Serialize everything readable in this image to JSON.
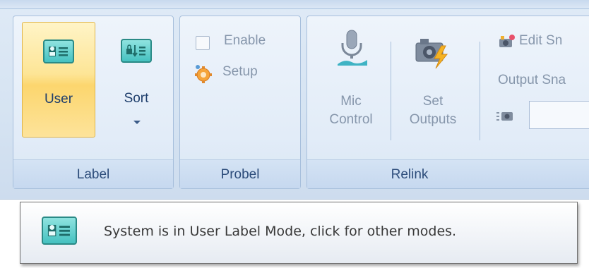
{
  "ribbon": {
    "label_group": {
      "title": "Label",
      "user_button": "User",
      "sort_button": "Sort"
    },
    "probel_group": {
      "title": "Probel",
      "enable_label": "Enable",
      "setup_label": "Setup"
    },
    "relink_group": {
      "title": "Relink",
      "mic_control_line1": "Mic",
      "mic_control_line2": "Control",
      "set_outputs_line1": "Set",
      "set_outputs_line2": "Outputs",
      "edit_snapshot_label": "Edit Sn",
      "output_snapshot_label": "Output Sna",
      "snapshot_input_value": ""
    }
  },
  "tooltip": {
    "text": "System is in User Label Mode, click for other modes."
  },
  "icons": {
    "user_label": "id-card-icon",
    "sort": "sort-list-icon",
    "setup": "gear-icon",
    "mic": "microphone-icon",
    "set_outputs": "camera-lightning-icon",
    "edit_snapshot": "camera-edit-icon",
    "snapshot": "snapshot-icon"
  },
  "colors": {
    "ribbon_bg": "#d5e3f2",
    "active_button": "#fcd66e",
    "label_text": "#2c4c7a",
    "disabled_text": "#8696ab",
    "teal_icon": "#45c1c0"
  }
}
